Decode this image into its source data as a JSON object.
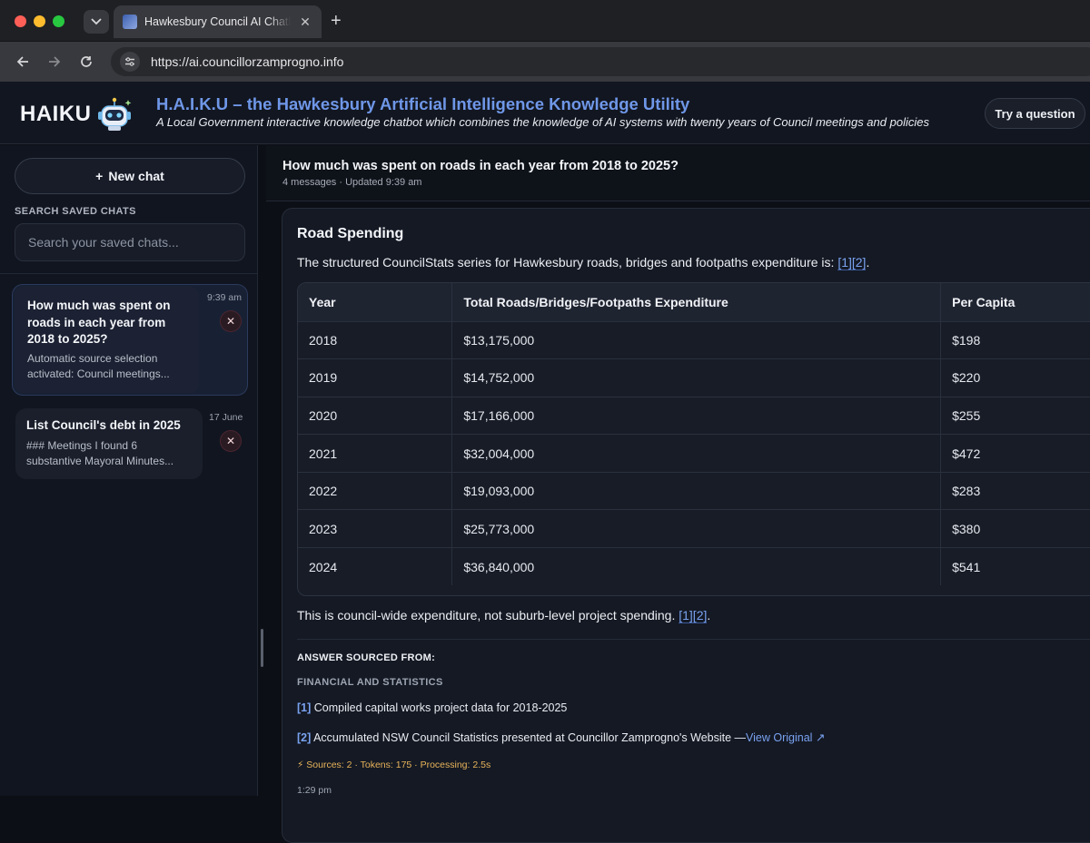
{
  "browser": {
    "tab_title": "Hawkesbury Council AI Chatbot",
    "url": "https://ai.councillorzamprogno.info"
  },
  "header": {
    "logo_text": "HAIKU",
    "title": "H.A.I.K.U – the Hawkesbury Artificial Intelligence Knowledge Utility",
    "subtitle": "A Local Government interactive knowledge chatbot which combines the knowledge of AI systems with twenty years of Council meetings and policies",
    "try_button": "Try a question"
  },
  "sidebar": {
    "new_chat": "New chat",
    "search_label": "SEARCH SAVED CHATS",
    "search_placeholder": "Search your saved chats...",
    "chats": [
      {
        "title_lines": [
          "How much was spent on",
          "roads in each year from",
          "2018 to 2025?"
        ],
        "snippet_lines": [
          "Automatic source selection",
          "activated: Council meetings..."
        ],
        "time": "9:39 am"
      },
      {
        "title_lines": [
          "List Council's debt in 2025"
        ],
        "snippet_lines": [
          "### Meetings I found 6",
          "substantive Mayoral Minutes..."
        ],
        "time": "17 June"
      }
    ]
  },
  "conversation": {
    "question": "How much was spent on roads in each year from 2018 to 2025?",
    "meta": "4 messages · Updated 9:39 am"
  },
  "answer": {
    "title": "Road Spending",
    "intro": "The structured CouncilStats series for Hawkesbury roads, bridges and footpaths expenditure is: ",
    "intro_cites": "[1][2]",
    "intro_end": ".",
    "table": {
      "headers": [
        "Year",
        "Total Roads/Bridges/Footpaths Expenditure",
        "Per Capita"
      ],
      "rows": [
        [
          "2018",
          "$13,175,000",
          "$198"
        ],
        [
          "2019",
          "$14,752,000",
          "$220"
        ],
        [
          "2020",
          "$17,166,000",
          "$255"
        ],
        [
          "2021",
          "$32,004,000",
          "$472"
        ],
        [
          "2022",
          "$19,093,000",
          "$283"
        ],
        [
          "2023",
          "$25,773,000",
          "$380"
        ],
        [
          "2024",
          "$36,840,000",
          "$541"
        ]
      ]
    },
    "note": "This is council-wide expenditure, not suburb-level project spending. ",
    "note_cites": "[1][2]",
    "note_end": ".",
    "sources_heading": "ANSWER SOURCED FROM:",
    "sources_category": "FINANCIAL AND STATISTICS",
    "sources": [
      {
        "num": "[1]",
        "text": " Compiled capital works project data for 2018-2025",
        "link": ""
      },
      {
        "num": "[2]",
        "text": " Accumulated NSW Council Statistics presented at Councillor Zamprogno's Website —",
        "link": "View Original ↗"
      }
    ],
    "stats": "⚡ Sources: 2 · Tokens: 175 · Processing: 2.5s",
    "time": "1:29 pm"
  }
}
